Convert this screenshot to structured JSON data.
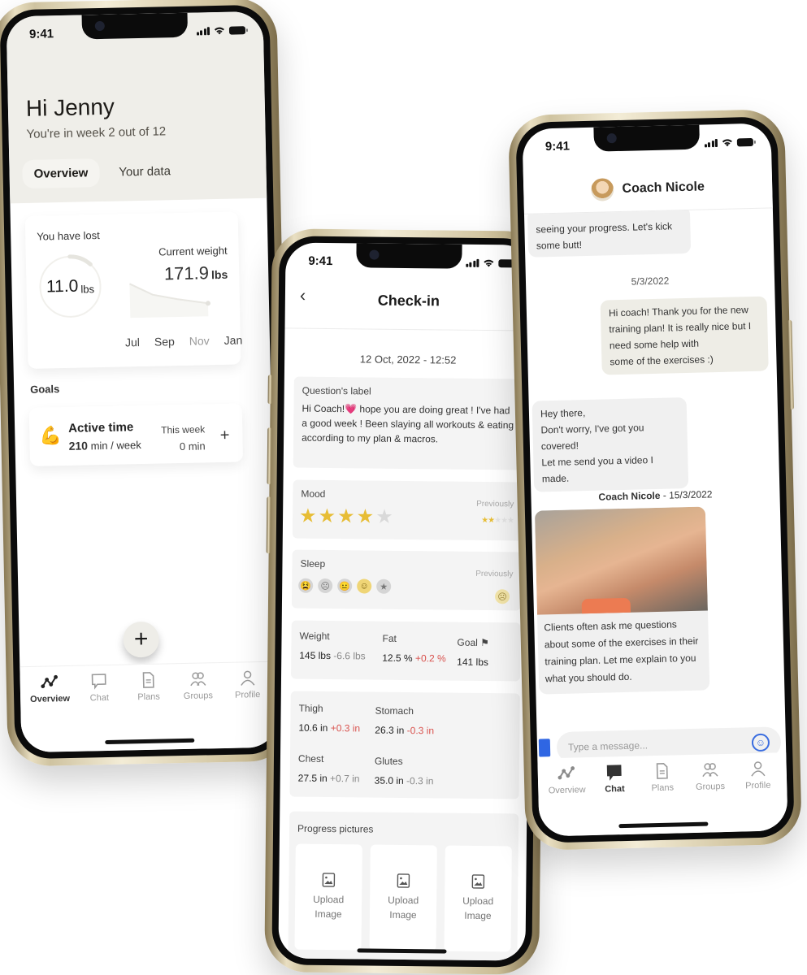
{
  "status_bar": {
    "time": "9:41"
  },
  "overview": {
    "greeting": "Hi Jenny",
    "subtitle": "You're in week 2 out of 12",
    "tabs": [
      {
        "label": "Overview",
        "active": true
      },
      {
        "label": "Your data",
        "active": false
      }
    ],
    "lost_card": {
      "label": "You have lost",
      "value": "11.0",
      "unit": "lbs",
      "ring_progress": 0.12
    },
    "weight_card": {
      "label": "Current weight",
      "value": "171.9",
      "unit": "lbs",
      "months": [
        "Jul",
        "Sep",
        "Nov",
        "Jan"
      ]
    },
    "goals_title": "Goals",
    "goal": {
      "icon": "flexed-biceps-icon",
      "title": "Active time",
      "target_value": "210",
      "target_unit": "min / week",
      "this_week_label": "This week",
      "this_week_value": "0 min"
    },
    "fab_label": "+"
  },
  "tabbar": {
    "items": [
      {
        "label": "Overview",
        "icon": "trend-icon"
      },
      {
        "label": "Chat",
        "icon": "chat-icon"
      },
      {
        "label": "Plans",
        "icon": "document-icon"
      },
      {
        "label": "Groups",
        "icon": "groups-icon"
      },
      {
        "label": "Profile",
        "icon": "profile-icon"
      }
    ]
  },
  "checkin": {
    "title": "Check-in",
    "back_label": "‹",
    "date": "12 Oct, 2022 - 12:52",
    "question": {
      "label": "Question's label",
      "answer": "Hi Coach!💗 hope you are doing great ! I've had a good week ! Been slaying all workouts & eating according to my plan & macros."
    },
    "mood": {
      "label": "Mood",
      "rating": 4,
      "max": 5,
      "previously_label": "Previously",
      "previous_rating": 2
    },
    "sleep": {
      "label": "Sleep",
      "selected_index": 3,
      "options": [
        "😫",
        "☹",
        "😐",
        "☺",
        "★"
      ],
      "previously_label": "Previously",
      "previous": "☹"
    },
    "body": {
      "weight": {
        "label": "Weight",
        "value": "145 lbs",
        "delta": "-6.6 lbs"
      },
      "fat": {
        "label": "Fat",
        "value": "12.5 %",
        "delta": "+0.2 %"
      },
      "goal": {
        "label": "Goal",
        "value": "141 lbs"
      }
    },
    "measurements": [
      {
        "label": "Thigh",
        "value": "10.6 in",
        "delta": "+0.3 in",
        "highlight": true
      },
      {
        "label": "Stomach",
        "value": "26.3 in",
        "delta": "-0.3 in",
        "highlight": true
      },
      {
        "label": "Chest",
        "value": "27.5 in",
        "delta": "+0.7 in",
        "highlight": false
      },
      {
        "label": "Glutes",
        "value": "35.0 in",
        "delta": "-0.3 in",
        "highlight": false
      }
    ],
    "progress_pictures": {
      "label": "Progress pictures",
      "upload_line1": "Upload",
      "upload_line2": "Image"
    }
  },
  "chat": {
    "coach_name": "Coach Nicole",
    "messages": [
      {
        "from": "coach",
        "text": "seeing your progress. Let's kick some butt!"
      },
      {
        "date": "5/3/2022"
      },
      {
        "from": "client",
        "text": "Hi coach! Thank you for the new training plan! It is really nice but I need some help with some of the exercises :)"
      },
      {
        "from": "coach",
        "text": "Hey there, Don't worry, I've got you covered! Let me send you a video I made."
      },
      {
        "sender": "Coach Nicole",
        "date": "15/3/2022"
      },
      {
        "from": "coach",
        "text": "Clients often ask me questions about some of the exercises in their training plan. Let me explain to you what you should do."
      }
    ],
    "msg1_line1": "seeing your progress. Let's kick",
    "msg1_line2": "some butt!",
    "date1": "5/3/2022",
    "msg2_lines": [
      "Hi coach! Thank you for the new",
      "training plan! It is really nice but I",
      "need some help with",
      "some of the exercises :)"
    ],
    "msg3_lines": [
      "Hey there,",
      "Don't worry, I've got you covered!",
      "Let me send you a video I made."
    ],
    "sender_name": "Coach Nicole",
    "sender_date": " - 15/3/2022",
    "msg4_lines": [
      "Clients often ask me questions",
      "about some of the exercises in their",
      "training plan. Let me explain to you",
      "what you should do."
    ],
    "input_placeholder": "Type a message..."
  },
  "colors": {
    "star": "#e7bd35",
    "delta_red": "#d9534f",
    "accent_blue": "#3a6de0",
    "frame_gold": "#e9dfc2"
  }
}
